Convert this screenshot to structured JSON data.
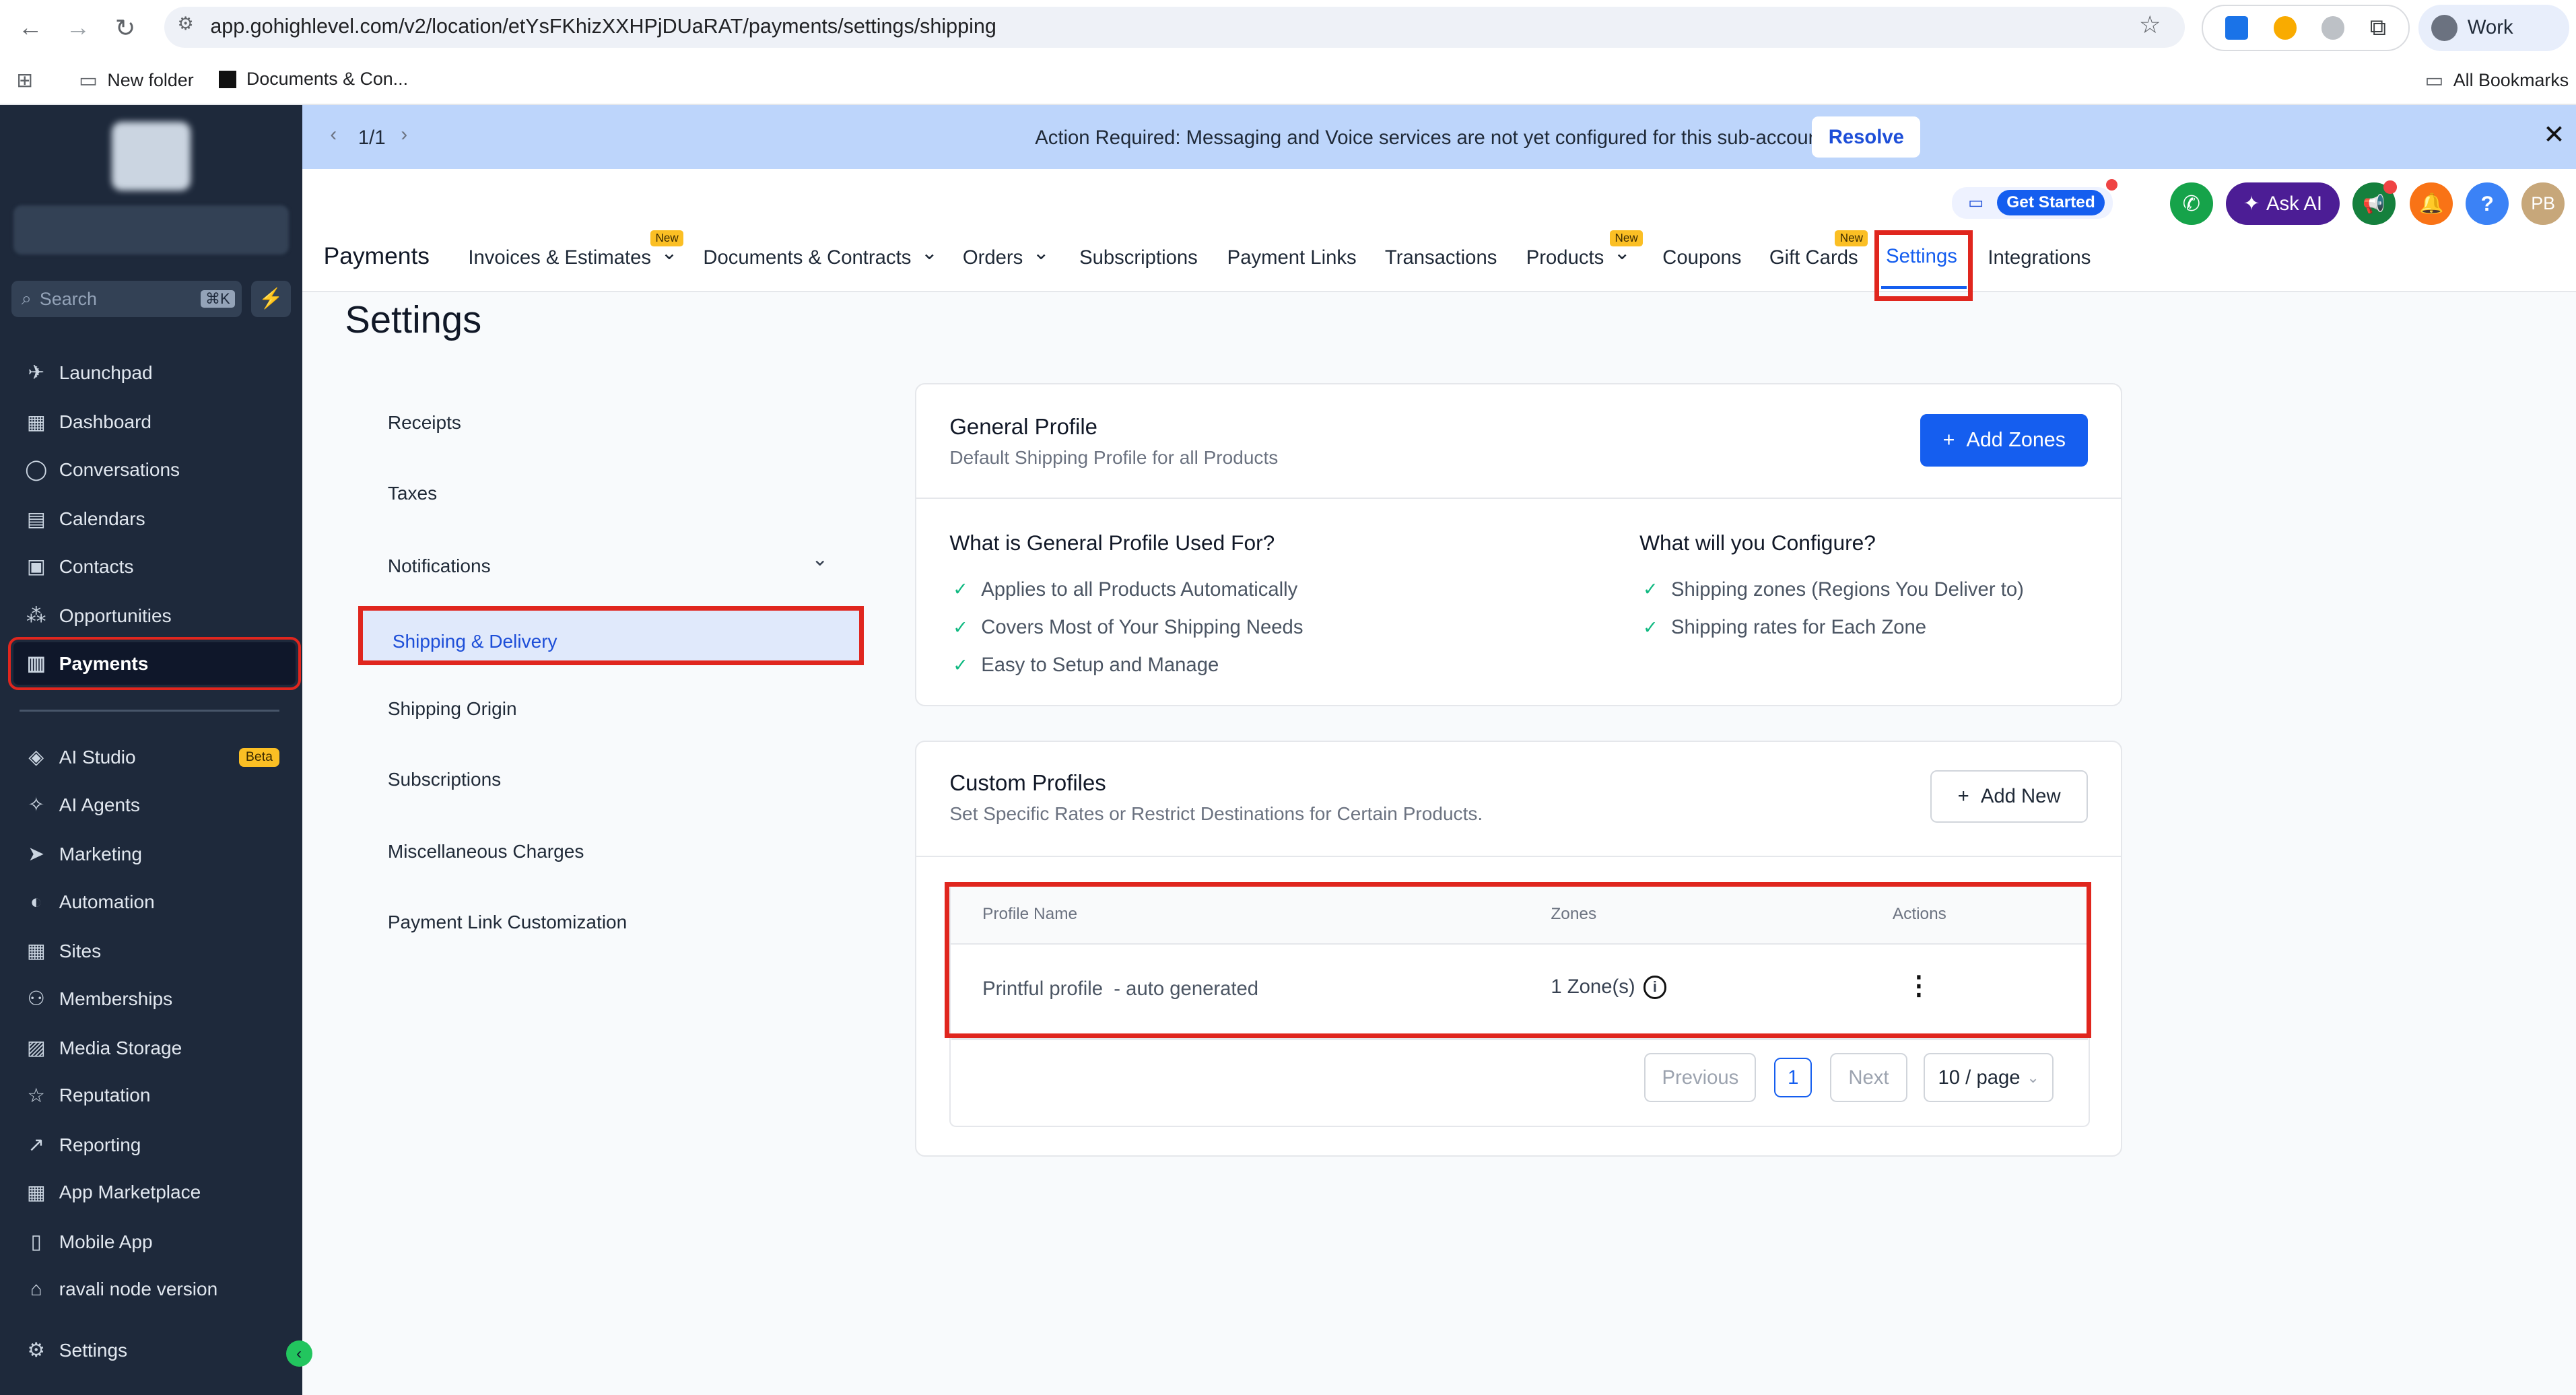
{
  "browser": {
    "url": "app.gohighlevel.com/v2/location/etYsFKhizXXHPjDUaRAT/payments/settings/shipping",
    "profile": "Work",
    "bookmarks": [
      {
        "label": "New folder"
      },
      {
        "label": "Documents & Con..."
      }
    ],
    "all_bookmarks": "All Bookmarks"
  },
  "sidebar": {
    "search_placeholder": "Search",
    "search_shortcut": "⌘K",
    "items": [
      {
        "label": "Launchpad",
        "icon": "rocket-icon"
      },
      {
        "label": "Dashboard",
        "icon": "grid-icon"
      },
      {
        "label": "Conversations",
        "icon": "chat-icon"
      },
      {
        "label": "Calendars",
        "icon": "calendar-icon"
      },
      {
        "label": "Contacts",
        "icon": "contacts-icon"
      },
      {
        "label": "Opportunities",
        "icon": "funnel-icon"
      },
      {
        "label": "Payments",
        "icon": "receipt-icon",
        "active": true
      },
      {
        "label": "AI Studio",
        "icon": "ai-icon",
        "badge": "Beta"
      },
      {
        "label": "AI Agents",
        "icon": "sparkle-icon"
      },
      {
        "label": "Marketing",
        "icon": "send-icon"
      },
      {
        "label": "Automation",
        "icon": "automation-icon"
      },
      {
        "label": "Sites",
        "icon": "sites-icon"
      },
      {
        "label": "Memberships",
        "icon": "memberships-icon"
      },
      {
        "label": "Media Storage",
        "icon": "image-icon"
      },
      {
        "label": "Reputation",
        "icon": "star-icon"
      },
      {
        "label": "Reporting",
        "icon": "chart-icon"
      },
      {
        "label": "App Marketplace",
        "icon": "apps-icon"
      },
      {
        "label": "Mobile App",
        "icon": "phone-icon"
      },
      {
        "label": "ravali node version",
        "icon": "building-icon"
      }
    ],
    "settings": "Settings"
  },
  "banner": {
    "pager": "1/1",
    "message": "Action Required: Messaging and Voice services are not yet configured for this sub-account!",
    "resolve": "Resolve"
  },
  "header": {
    "get_started": "Get Started",
    "ask_ai": "Ask AI",
    "avatar": "PB",
    "help": "?",
    "section": "Payments",
    "new_badge": "New",
    "tabs": [
      {
        "label": "Invoices & Estimates",
        "new": true,
        "dropdown": true
      },
      {
        "label": "Documents & Contracts",
        "dropdown": true
      },
      {
        "label": "Orders",
        "dropdown": true
      },
      {
        "label": "Subscriptions"
      },
      {
        "label": "Payment Links"
      },
      {
        "label": "Transactions"
      },
      {
        "label": "Products",
        "new": true,
        "dropdown": true
      },
      {
        "label": "Coupons"
      },
      {
        "label": "Gift Cards",
        "new": true
      },
      {
        "label": "Settings",
        "active": true
      },
      {
        "label": "Integrations"
      }
    ]
  },
  "page": {
    "title": "Settings",
    "menu": [
      "Receipts",
      "Taxes",
      "Notifications",
      "Shipping & Delivery",
      "Shipping Origin",
      "Subscriptions",
      "Miscellaneous Charges",
      "Payment Link Customization"
    ],
    "general": {
      "title": "General Profile",
      "subtitle": "Default Shipping Profile for all Products",
      "add_zones": "Add Zones",
      "used_for_title": "What is General Profile Used For?",
      "used_for": [
        "Applies to all Products Automatically",
        "Covers Most of Your Shipping Needs",
        "Easy to Setup and Manage"
      ],
      "configure_title": "What will you Configure?",
      "configure": [
        "Shipping zones (Regions You Deliver to)",
        "Shipping rates for Each Zone"
      ]
    },
    "custom": {
      "title": "Custom Profiles",
      "subtitle": "Set Specific Rates or Restrict Destinations for Certain Products.",
      "add_new": "Add New",
      "columns": [
        "Profile Name",
        "Zones",
        "Actions"
      ],
      "rows": [
        {
          "name": "Printful profile  - auto generated",
          "zones": "1 Zone(s)"
        }
      ],
      "pagination": {
        "previous": "Previous",
        "page": "1",
        "next": "Next",
        "per_page": "10 / page"
      }
    }
  },
  "colors": {
    "accent": "#155eef",
    "highlight": "#e0261e",
    "sidebar": "#1e293b",
    "banner": "#bdd5fb"
  }
}
